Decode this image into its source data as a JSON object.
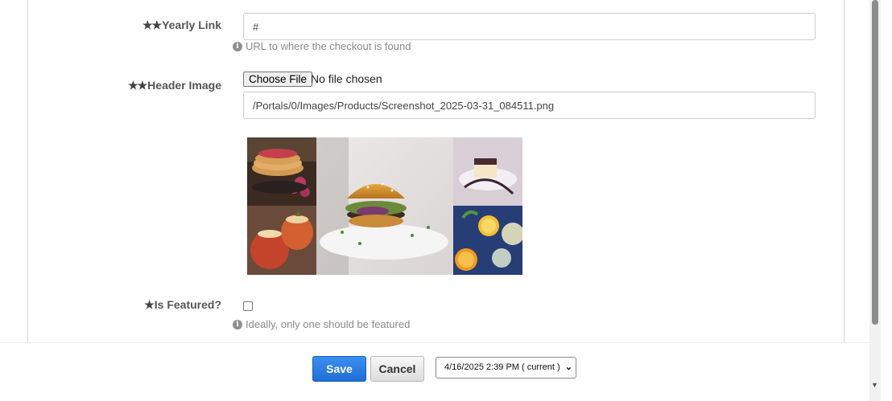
{
  "fields": {
    "yearly_link": {
      "label": "Yearly Link",
      "stars": "★★",
      "value": "#",
      "help": "URL to where the checkout is found"
    },
    "header_image": {
      "label": "Header Image",
      "stars": "★★",
      "choose_file_label": "Choose File",
      "file_status": "No file chosen",
      "path_value": "/Portals/0/Images/Products/Screenshot_2025-03-31_084511.png"
    },
    "is_featured": {
      "label": "Is Featured?",
      "stars": "★",
      "checked": false,
      "help": "Ideally, only one should be featured"
    }
  },
  "icons": {
    "info": "i"
  },
  "actions": {
    "save_label": "Save",
    "cancel_label": "Cancel",
    "version_selected": "4/16/2025 2:39 PM ( current )"
  },
  "colors": {
    "save_button": "#2a7ae2",
    "help_text": "#8a8a8a"
  }
}
